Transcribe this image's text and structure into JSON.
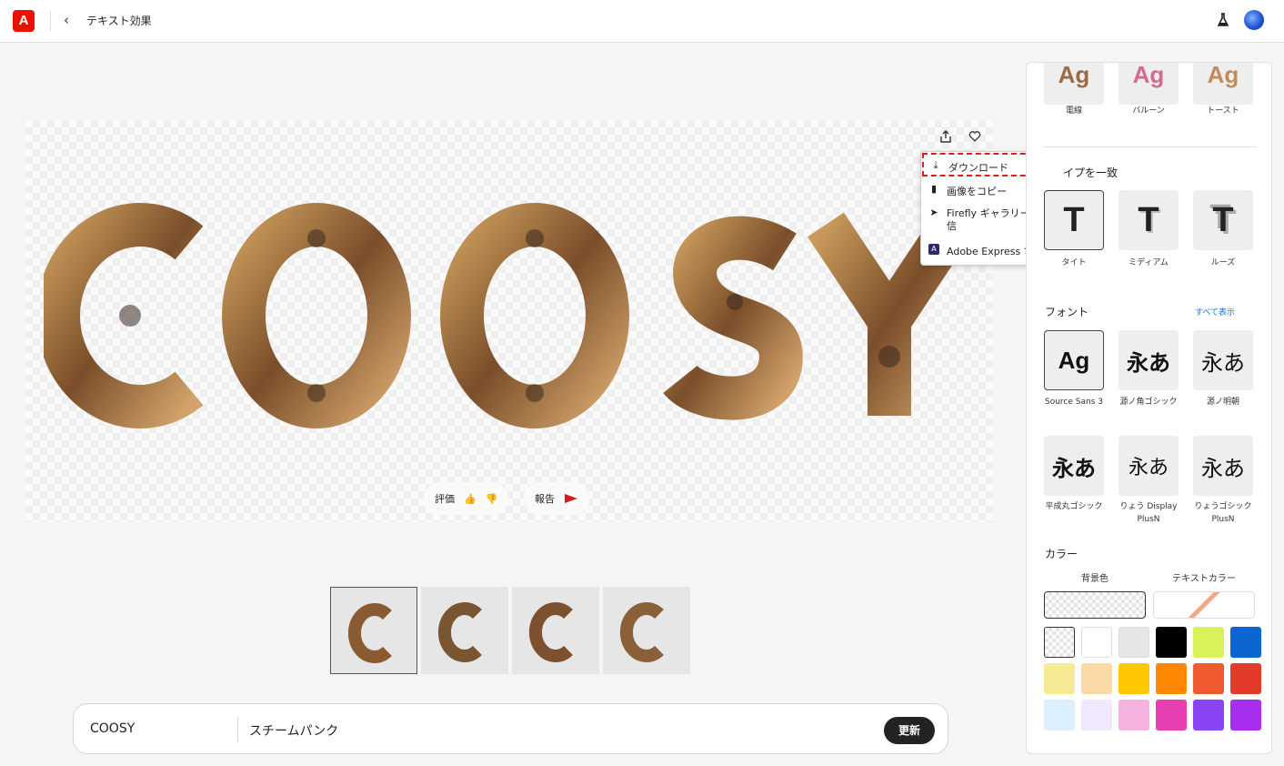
{
  "app": {
    "logo_glyph": "A",
    "back_glyph": "‹",
    "title": "テキスト効果"
  },
  "canvas": {
    "text": "COOSY",
    "rate_label": "評価",
    "report_label": "報告"
  },
  "menu": {
    "items": [
      "ダウンロード",
      "画像をコピー",
      "Firefly ギャラリーに送信",
      "Adobe Express で編集"
    ]
  },
  "thumbnails": {
    "count": 4,
    "selected_index": 0
  },
  "prompt": {
    "text_value": "COOSY",
    "style_value": "スチームパンク",
    "update_label": "更新"
  },
  "panel": {
    "effects": [
      {
        "label": "電線"
      },
      {
        "label": "バルーン"
      },
      {
        "label": "トースト"
      }
    ],
    "match_type": {
      "heading": "イプを一致",
      "items": [
        {
          "label": "タイト"
        },
        {
          "label": "ミディアム"
        },
        {
          "label": "ルーズ"
        }
      ]
    },
    "font": {
      "heading": "フォント",
      "show_all": "すべて表示",
      "items": [
        {
          "glyph": "Ag",
          "label": "Source Sans 3"
        },
        {
          "glyph": "永あ",
          "label": "源ノ角ゴシック"
        },
        {
          "glyph": "永あ",
          "label": "源ノ明朝"
        },
        {
          "glyph": "永あ",
          "label": "平成丸ゴシック"
        },
        {
          "glyph": "永あ",
          "label": "りょう Display PlusN"
        },
        {
          "glyph": "永あ",
          "label": "りょうゴシック PlusN"
        }
      ]
    },
    "color": {
      "heading": "カラー",
      "bg_label": "背景色",
      "text_label": "テキストカラー",
      "swatches": [
        "transparent",
        "#ffffff",
        "#e6e6e6",
        "#000000",
        "#d9f25a",
        "#0d66d0",
        "#f7ea94",
        "#fbd9a6",
        "#ffc800",
        "#ff8800",
        "#f05a30",
        "#e23b2b",
        "#dcefff",
        "#efe8ff",
        "#f7b3e0",
        "#e83fb2",
        "#8a43f5",
        "#a62ef0"
      ]
    }
  }
}
